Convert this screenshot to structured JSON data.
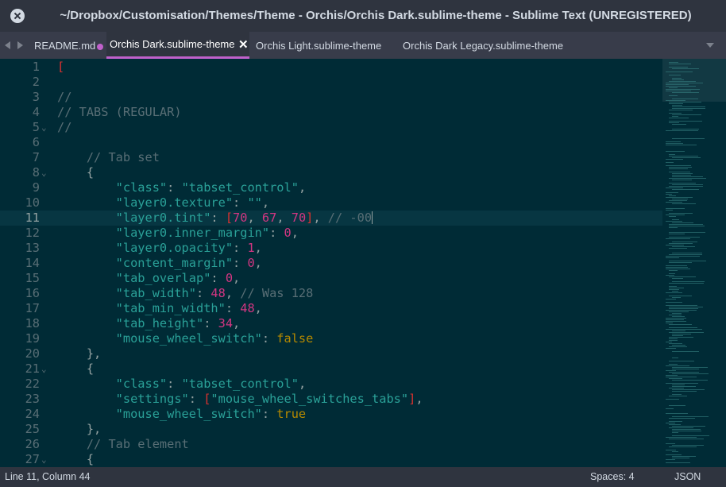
{
  "window": {
    "title": "~/Dropbox/Customisation/Themes/Theme - Orchis/Orchis Dark.sublime-theme - Sublime Text (UNREGISTERED)"
  },
  "tabs": [
    {
      "label": "README.md",
      "active": false
    },
    {
      "label": "Orchis Dark.sublime-theme",
      "active": true,
      "dirty": true
    },
    {
      "label": "Orchis Light.sublime-theme",
      "active": false
    },
    {
      "label": "Orchis Dark Legacy.sublime-theme",
      "active": false
    }
  ],
  "editor": {
    "current_line": 11,
    "lines": [
      {
        "n": "1",
        "fold": false,
        "tokens": [
          [
            "b",
            "["
          ]
        ]
      },
      {
        "n": "2",
        "fold": false,
        "tokens": []
      },
      {
        "n": "3",
        "fold": false,
        "tokens": [
          [
            "c",
            "//"
          ]
        ]
      },
      {
        "n": "4",
        "fold": false,
        "tokens": [
          [
            "c",
            "// TABS (REGULAR)"
          ]
        ]
      },
      {
        "n": "5",
        "fold": true,
        "tokens": [
          [
            "c",
            "//"
          ]
        ]
      },
      {
        "n": "6",
        "fold": false,
        "tokens": []
      },
      {
        "n": "7",
        "fold": false,
        "tokens": [
          [
            "c",
            "    // Tab set"
          ]
        ]
      },
      {
        "n": "8",
        "fold": true,
        "tokens": [
          [
            "p",
            "    {"
          ]
        ]
      },
      {
        "n": "9",
        "fold": false,
        "tokens": [
          [
            "s",
            "        \"class\""
          ],
          [
            "p",
            ": "
          ],
          [
            "s",
            "\"tabset_control\""
          ],
          [
            "p",
            ","
          ]
        ]
      },
      {
        "n": "10",
        "fold": false,
        "tokens": [
          [
            "s",
            "        \"layer0.texture\""
          ],
          [
            "p",
            ": "
          ],
          [
            "s",
            "\"\""
          ],
          [
            "p",
            ","
          ]
        ]
      },
      {
        "n": "11",
        "fold": false,
        "tokens": [
          [
            "s",
            "        \"layer0.tint\""
          ],
          [
            "p",
            ": "
          ],
          [
            "b",
            "["
          ],
          [
            "n",
            "70"
          ],
          [
            "p",
            ", "
          ],
          [
            "n",
            "67"
          ],
          [
            "p",
            ", "
          ],
          [
            "n",
            "70"
          ],
          [
            "b",
            "]"
          ],
          [
            "p",
            ", "
          ],
          [
            "c",
            "// -00"
          ]
        ]
      },
      {
        "n": "12",
        "fold": false,
        "tokens": [
          [
            "s",
            "        \"layer0.inner_margin\""
          ],
          [
            "p",
            ": "
          ],
          [
            "n",
            "0"
          ],
          [
            "p",
            ","
          ]
        ]
      },
      {
        "n": "13",
        "fold": false,
        "tokens": [
          [
            "s",
            "        \"layer0.opacity\""
          ],
          [
            "p",
            ": "
          ],
          [
            "n",
            "1"
          ],
          [
            "p",
            ","
          ]
        ]
      },
      {
        "n": "14",
        "fold": false,
        "tokens": [
          [
            "s",
            "        \"content_margin\""
          ],
          [
            "p",
            ": "
          ],
          [
            "n",
            "0"
          ],
          [
            "p",
            ","
          ]
        ]
      },
      {
        "n": "15",
        "fold": false,
        "tokens": [
          [
            "s",
            "        \"tab_overlap\""
          ],
          [
            "p",
            ": "
          ],
          [
            "n",
            "0"
          ],
          [
            "p",
            ","
          ]
        ]
      },
      {
        "n": "16",
        "fold": false,
        "tokens": [
          [
            "s",
            "        \"tab_width\""
          ],
          [
            "p",
            ": "
          ],
          [
            "n",
            "48"
          ],
          [
            "p",
            ", "
          ],
          [
            "c",
            "// Was 128"
          ]
        ]
      },
      {
        "n": "17",
        "fold": false,
        "tokens": [
          [
            "s",
            "        \"tab_min_width\""
          ],
          [
            "p",
            ": "
          ],
          [
            "n",
            "48"
          ],
          [
            "p",
            ","
          ]
        ]
      },
      {
        "n": "18",
        "fold": false,
        "tokens": [
          [
            "s",
            "        \"tab_height\""
          ],
          [
            "p",
            ": "
          ],
          [
            "n",
            "34"
          ],
          [
            "p",
            ","
          ]
        ]
      },
      {
        "n": "19",
        "fold": false,
        "tokens": [
          [
            "s",
            "        \"mouse_wheel_switch\""
          ],
          [
            "p",
            ": "
          ],
          [
            "k",
            "false"
          ]
        ]
      },
      {
        "n": "20",
        "fold": false,
        "tokens": [
          [
            "p",
            "    },"
          ]
        ]
      },
      {
        "n": "21",
        "fold": true,
        "tokens": [
          [
            "p",
            "    {"
          ]
        ]
      },
      {
        "n": "22",
        "fold": false,
        "tokens": [
          [
            "s",
            "        \"class\""
          ],
          [
            "p",
            ": "
          ],
          [
            "s",
            "\"tabset_control\""
          ],
          [
            "p",
            ","
          ]
        ]
      },
      {
        "n": "23",
        "fold": false,
        "tokens": [
          [
            "s",
            "        \"settings\""
          ],
          [
            "p",
            ": "
          ],
          [
            "b",
            "["
          ],
          [
            "s",
            "\"mouse_wheel_switches_tabs\""
          ],
          [
            "b",
            "]"
          ],
          [
            "p",
            ","
          ]
        ]
      },
      {
        "n": "24",
        "fold": false,
        "tokens": [
          [
            "s",
            "        \"mouse_wheel_switch\""
          ],
          [
            "p",
            ": "
          ],
          [
            "k",
            "true"
          ]
        ]
      },
      {
        "n": "25",
        "fold": false,
        "tokens": [
          [
            "p",
            "    },"
          ]
        ]
      },
      {
        "n": "26",
        "fold": false,
        "tokens": [
          [
            "c",
            "    // Tab element"
          ]
        ]
      },
      {
        "n": "27",
        "fold": true,
        "tokens": [
          [
            "p",
            "    {"
          ]
        ]
      }
    ]
  },
  "status": {
    "position": "Line 11, Column 44",
    "indentation": "Spaces: 4",
    "syntax": "JSON"
  },
  "colors": {
    "background": "#002b36",
    "string": "#2aa198",
    "number": "#d33682",
    "keyword": "#b58900",
    "comment": "#586e75",
    "bracket": "#dc322f",
    "accent": "#c061cb"
  },
  "icons": [
    "close-icon",
    "arrow-left-icon",
    "arrow-right-icon",
    "modified-dot-icon",
    "tab-close-icon",
    "tab-dropdown-icon",
    "fold-chevron-icon"
  ]
}
